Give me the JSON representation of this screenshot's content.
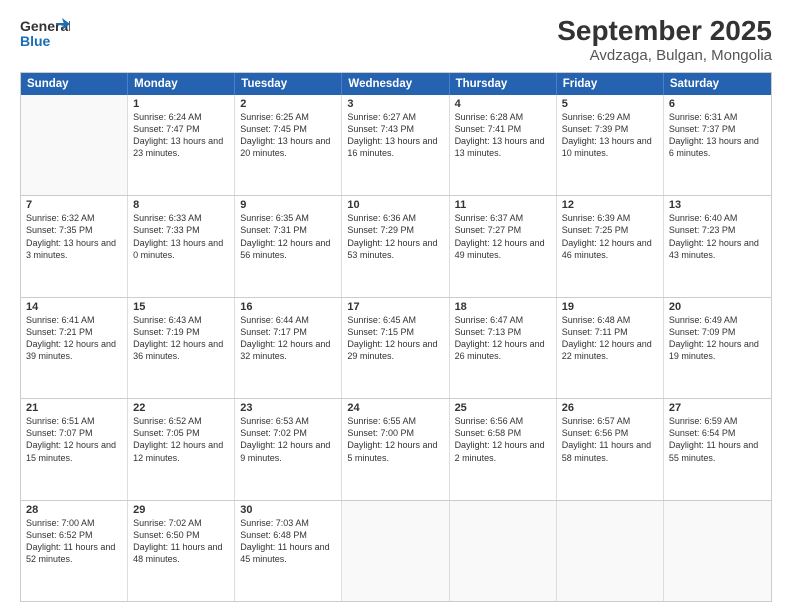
{
  "logo": {
    "general": "General",
    "blue": "Blue"
  },
  "title": "September 2025",
  "subtitle": "Avdzaga, Bulgan, Mongolia",
  "weekdays": [
    "Sunday",
    "Monday",
    "Tuesday",
    "Wednesday",
    "Thursday",
    "Friday",
    "Saturday"
  ],
  "rows": [
    [
      {
        "day": null
      },
      {
        "day": "1",
        "rise": "6:24 AM",
        "set": "7:47 PM",
        "daylight": "13 hours and 23 minutes."
      },
      {
        "day": "2",
        "rise": "6:25 AM",
        "set": "7:45 PM",
        "daylight": "13 hours and 20 minutes."
      },
      {
        "day": "3",
        "rise": "6:27 AM",
        "set": "7:43 PM",
        "daylight": "13 hours and 16 minutes."
      },
      {
        "day": "4",
        "rise": "6:28 AM",
        "set": "7:41 PM",
        "daylight": "13 hours and 13 minutes."
      },
      {
        "day": "5",
        "rise": "6:29 AM",
        "set": "7:39 PM",
        "daylight": "13 hours and 10 minutes."
      },
      {
        "day": "6",
        "rise": "6:31 AM",
        "set": "7:37 PM",
        "daylight": "13 hours and 6 minutes."
      }
    ],
    [
      {
        "day": "7",
        "rise": "6:32 AM",
        "set": "7:35 PM",
        "daylight": "13 hours and 3 minutes."
      },
      {
        "day": "8",
        "rise": "6:33 AM",
        "set": "7:33 PM",
        "daylight": "13 hours and 0 minutes."
      },
      {
        "day": "9",
        "rise": "6:35 AM",
        "set": "7:31 PM",
        "daylight": "12 hours and 56 minutes."
      },
      {
        "day": "10",
        "rise": "6:36 AM",
        "set": "7:29 PM",
        "daylight": "12 hours and 53 minutes."
      },
      {
        "day": "11",
        "rise": "6:37 AM",
        "set": "7:27 PM",
        "daylight": "12 hours and 49 minutes."
      },
      {
        "day": "12",
        "rise": "6:39 AM",
        "set": "7:25 PM",
        "daylight": "12 hours and 46 minutes."
      },
      {
        "day": "13",
        "rise": "6:40 AM",
        "set": "7:23 PM",
        "daylight": "12 hours and 43 minutes."
      }
    ],
    [
      {
        "day": "14",
        "rise": "6:41 AM",
        "set": "7:21 PM",
        "daylight": "12 hours and 39 minutes."
      },
      {
        "day": "15",
        "rise": "6:43 AM",
        "set": "7:19 PM",
        "daylight": "12 hours and 36 minutes."
      },
      {
        "day": "16",
        "rise": "6:44 AM",
        "set": "7:17 PM",
        "daylight": "12 hours and 32 minutes."
      },
      {
        "day": "17",
        "rise": "6:45 AM",
        "set": "7:15 PM",
        "daylight": "12 hours and 29 minutes."
      },
      {
        "day": "18",
        "rise": "6:47 AM",
        "set": "7:13 PM",
        "daylight": "12 hours and 26 minutes."
      },
      {
        "day": "19",
        "rise": "6:48 AM",
        "set": "7:11 PM",
        "daylight": "12 hours and 22 minutes."
      },
      {
        "day": "20",
        "rise": "6:49 AM",
        "set": "7:09 PM",
        "daylight": "12 hours and 19 minutes."
      }
    ],
    [
      {
        "day": "21",
        "rise": "6:51 AM",
        "set": "7:07 PM",
        "daylight": "12 hours and 15 minutes."
      },
      {
        "day": "22",
        "rise": "6:52 AM",
        "set": "7:05 PM",
        "daylight": "12 hours and 12 minutes."
      },
      {
        "day": "23",
        "rise": "6:53 AM",
        "set": "7:02 PM",
        "daylight": "12 hours and 9 minutes."
      },
      {
        "day": "24",
        "rise": "6:55 AM",
        "set": "7:00 PM",
        "daylight": "12 hours and 5 minutes."
      },
      {
        "day": "25",
        "rise": "6:56 AM",
        "set": "6:58 PM",
        "daylight": "12 hours and 2 minutes."
      },
      {
        "day": "26",
        "rise": "6:57 AM",
        "set": "6:56 PM",
        "daylight": "11 hours and 58 minutes."
      },
      {
        "day": "27",
        "rise": "6:59 AM",
        "set": "6:54 PM",
        "daylight": "11 hours and 55 minutes."
      }
    ],
    [
      {
        "day": "28",
        "rise": "7:00 AM",
        "set": "6:52 PM",
        "daylight": "11 hours and 52 minutes."
      },
      {
        "day": "29",
        "rise": "7:02 AM",
        "set": "6:50 PM",
        "daylight": "11 hours and 48 minutes."
      },
      {
        "day": "30",
        "rise": "7:03 AM",
        "set": "6:48 PM",
        "daylight": "11 hours and 45 minutes."
      },
      {
        "day": null
      },
      {
        "day": null
      },
      {
        "day": null
      },
      {
        "day": null
      }
    ]
  ]
}
